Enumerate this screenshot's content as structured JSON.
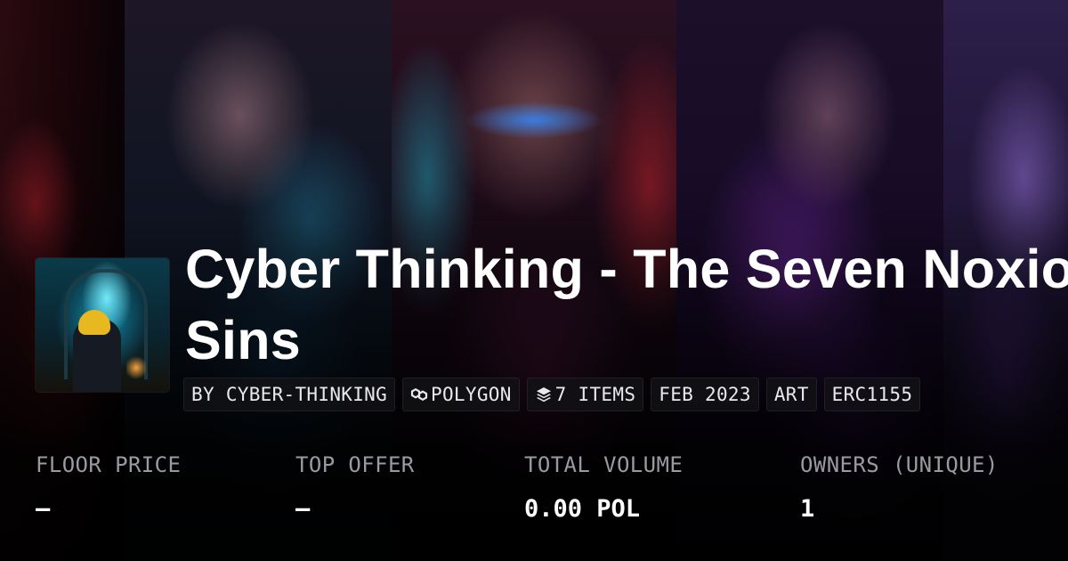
{
  "collection": {
    "title": "Cyber Thinking - The Seven Noxious Sins"
  },
  "tags": [
    {
      "label": "BY CYBER-THINKING",
      "icon": null
    },
    {
      "label": "POLYGON",
      "icon": "polygon-icon"
    },
    {
      "label": "7 ITEMS",
      "icon": "layers-icon"
    },
    {
      "label": "FEB 2023",
      "icon": null
    },
    {
      "label": "ART",
      "icon": null
    },
    {
      "label": "ERC1155",
      "icon": null
    }
  ],
  "stats": [
    {
      "label": "FLOOR PRICE",
      "value": "—"
    },
    {
      "label": "TOP OFFER",
      "value": "—"
    },
    {
      "label": "TOTAL VOLUME",
      "value": "0.00 POL"
    },
    {
      "label": "OWNERS (UNIQUE)",
      "value": "1"
    }
  ],
  "colors": {
    "text": "#ffffff",
    "muted": "#9a9aa2",
    "tag_background": "#121216"
  }
}
